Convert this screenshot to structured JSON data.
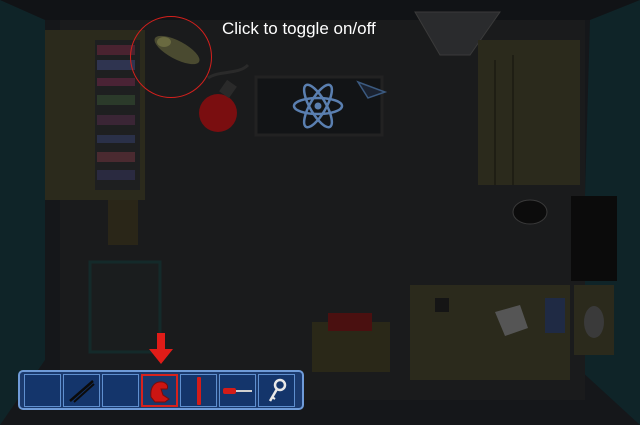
{
  "hint": {
    "text": "Click to toggle on/off"
  },
  "colors": {
    "background": "#0d0f12",
    "toggle_ring": "#d4201c",
    "inventory_bg": "#1b3a6e",
    "inventory_border": "#6f9bd8",
    "selection": "#d7221d",
    "poster_symbol": "#5a7fb0"
  },
  "inventory": {
    "selected_index": 3,
    "slots": [
      {
        "item": "empty"
      },
      {
        "item": "tweezers-icon"
      },
      {
        "item": "empty"
      },
      {
        "item": "red-glove-icon"
      },
      {
        "item": "red-rod-icon"
      },
      {
        "item": "screwdriver-icon"
      },
      {
        "item": "key-icon"
      }
    ]
  }
}
